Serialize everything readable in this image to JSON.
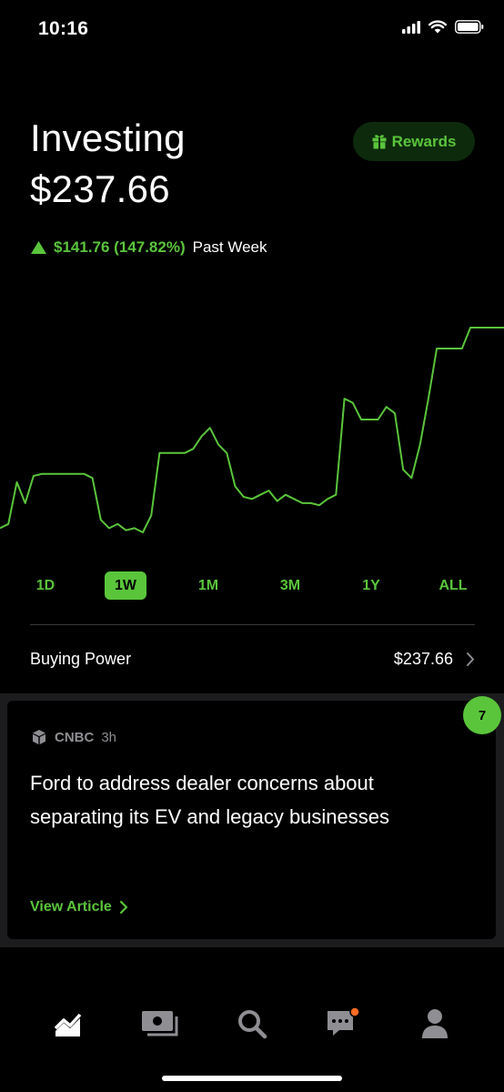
{
  "status_bar": {
    "time": "10:16"
  },
  "header": {
    "title": "Investing",
    "balance": "$237.66",
    "rewards_label": "Rewards",
    "change": "$141.76 (147.82%)",
    "period": "Past Week"
  },
  "colors": {
    "accent": "#5ac53b",
    "background": "#000000",
    "card_gap": "#1c1c1e",
    "notification_dot": "#ff6b22"
  },
  "chart_data": {
    "type": "line",
    "xlabel": "",
    "ylabel": "",
    "grid": false,
    "series": [
      {
        "values": [
          0,
          0.02,
          0.22,
          0.12,
          0.25,
          0.26,
          0.26,
          0.26,
          0.26,
          0.26,
          0.26,
          0.24,
          0.04,
          0.0,
          0.02,
          -0.01,
          0.0,
          -0.02,
          0.06,
          0.36,
          0.36,
          0.36,
          0.36,
          0.38,
          0.44,
          0.48,
          0.4,
          0.36,
          0.2,
          0.15,
          0.14,
          0.16,
          0.18,
          0.13,
          0.16,
          0.14,
          0.12,
          0.12,
          0.11,
          0.14,
          0.16,
          0.62,
          0.6,
          0.52,
          0.52,
          0.52,
          0.58,
          0.55,
          0.28,
          0.24,
          0.4,
          0.62,
          0.86,
          0.86,
          0.86,
          0.86,
          0.96,
          0.96,
          0.96,
          0.96,
          0.96
        ]
      }
    ]
  },
  "ranges": {
    "selected": "1W",
    "items": [
      "1D",
      "1W",
      "1M",
      "3M",
      "1Y",
      "ALL"
    ]
  },
  "buying_power": {
    "label": "Buying Power",
    "value": "$237.66"
  },
  "news": {
    "count": "7",
    "source": "CNBC",
    "time": "3h",
    "headline": "Ford to address dealer concerns about separating its EV and legacy businesses",
    "cta": "View Article"
  },
  "tabbar": {
    "items": [
      {
        "icon": "chart-icon",
        "active": true
      },
      {
        "icon": "cash-icon",
        "active": false
      },
      {
        "icon": "search-icon",
        "active": false
      },
      {
        "icon": "messages-icon",
        "active": false,
        "badge": true
      },
      {
        "icon": "account-icon",
        "active": false
      }
    ]
  }
}
